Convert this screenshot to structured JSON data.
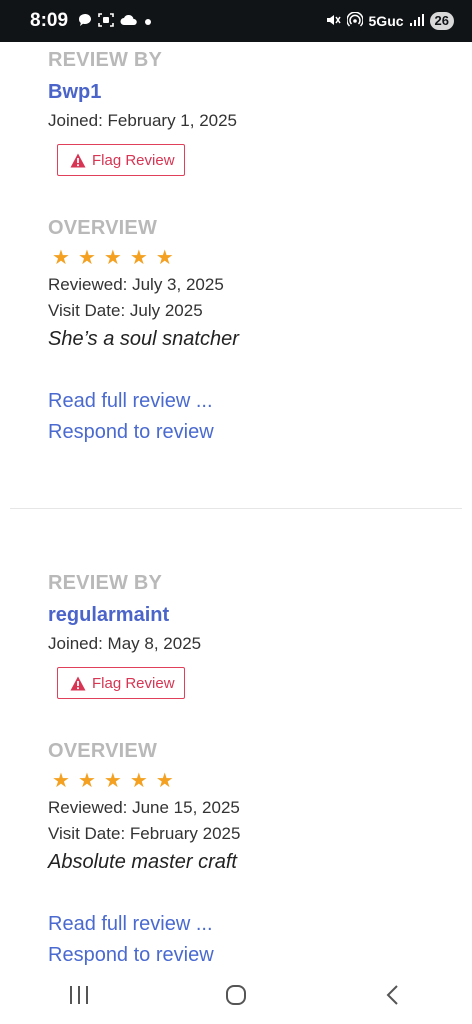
{
  "status_bar": {
    "time": "8:09",
    "network": "5Guc",
    "battery": "26",
    "icons": [
      "chat-icon",
      "screenshot-icon",
      "cloud-icon",
      "dot-icon",
      "mute-icon",
      "hotspot-icon",
      "signal-icon"
    ]
  },
  "reviews": [
    {
      "review_by_label": "REVIEW BY",
      "username": "Bwp1",
      "joined": "Joined: February 1, 2025",
      "flag_label": "Flag Review",
      "overview_label": "OVERVIEW",
      "stars": [
        "★",
        "★",
        "★",
        "★",
        "★"
      ],
      "reviewed": "Reviewed: July 3, 2025",
      "visit_date": "Visit Date: July 2025",
      "quote": "She’s a soul snatcher",
      "read_full": "Read full review ...",
      "respond": "Respond to review"
    },
    {
      "review_by_label": "REVIEW BY",
      "username": "regularmaint",
      "joined": "Joined: May 8, 2025",
      "flag_label": "Flag Review",
      "overview_label": "OVERVIEW",
      "stars": [
        "★",
        "★",
        "★",
        "★",
        "★"
      ],
      "reviewed": "Reviewed: June 15, 2025",
      "visit_date": "Visit Date: February 2025",
      "quote": "Absolute master craft",
      "read_full": "Read full review ...",
      "respond": "Respond to review"
    }
  ],
  "colors": {
    "accent": "#4a64c9",
    "flag": "#d73553",
    "star": "#f4a020",
    "muted": "#b9b9b9"
  }
}
